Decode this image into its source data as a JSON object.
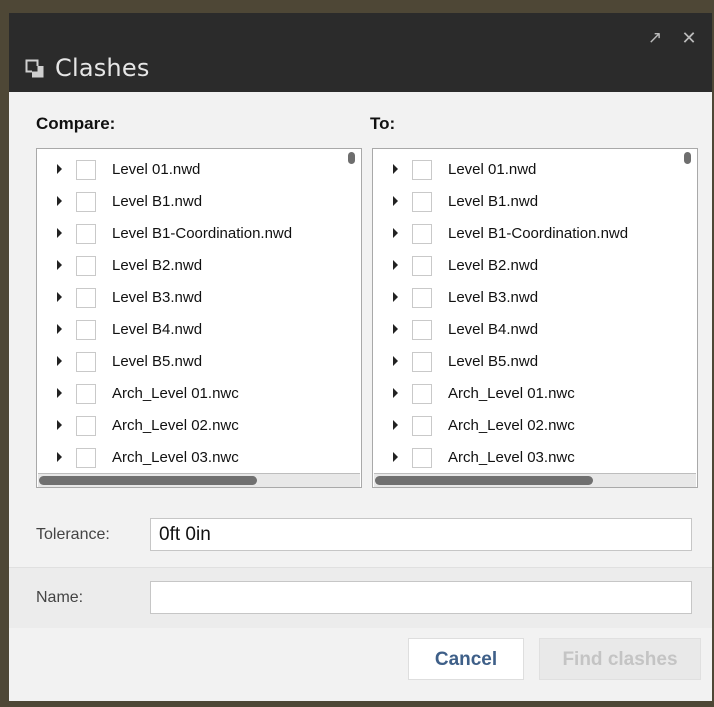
{
  "window": {
    "title": "Clashes",
    "icon": "clashes-icon",
    "dock_glyph": "↗",
    "close_glyph": "✕"
  },
  "compare": {
    "label": "Compare:",
    "items": [
      {
        "label": "Level 01.nwd",
        "checked": false
      },
      {
        "label": "Level B1.nwd",
        "checked": false
      },
      {
        "label": "Level B1-Coordination.nwd",
        "checked": false
      },
      {
        "label": "Level B2.nwd",
        "checked": false
      },
      {
        "label": "Level B3.nwd",
        "checked": false
      },
      {
        "label": "Level B4.nwd",
        "checked": false
      },
      {
        "label": "Level B5.nwd",
        "checked": false
      },
      {
        "label": "Arch_Level 01.nwc",
        "checked": false
      },
      {
        "label": "Arch_Level 02.nwc",
        "checked": false
      },
      {
        "label": "Arch_Level 03.nwc",
        "checked": false
      }
    ]
  },
  "to": {
    "label": "To:",
    "items": [
      {
        "label": "Level 01.nwd",
        "checked": false
      },
      {
        "label": "Level B1.nwd",
        "checked": false
      },
      {
        "label": "Level B1-Coordination.nwd",
        "checked": false
      },
      {
        "label": "Level B2.nwd",
        "checked": false
      },
      {
        "label": "Level B3.nwd",
        "checked": false
      },
      {
        "label": "Level B4.nwd",
        "checked": false
      },
      {
        "label": "Level B5.nwd",
        "checked": false
      },
      {
        "label": "Arch_Level 01.nwc",
        "checked": false
      },
      {
        "label": "Arch_Level 02.nwc",
        "checked": false
      },
      {
        "label": "Arch_Level 03.nwc",
        "checked": false
      }
    ]
  },
  "tolerance": {
    "label": "Tolerance:",
    "value": "0ft 0in"
  },
  "name": {
    "label": "Name:",
    "value": "",
    "placeholder": ""
  },
  "buttons": {
    "cancel": "Cancel",
    "find": "Find clashes",
    "find_enabled": false
  },
  "colors": {
    "titlebar": "#2b2b2b",
    "cancel_text": "#3e5f88",
    "disabled_text": "#c4c4c4"
  }
}
